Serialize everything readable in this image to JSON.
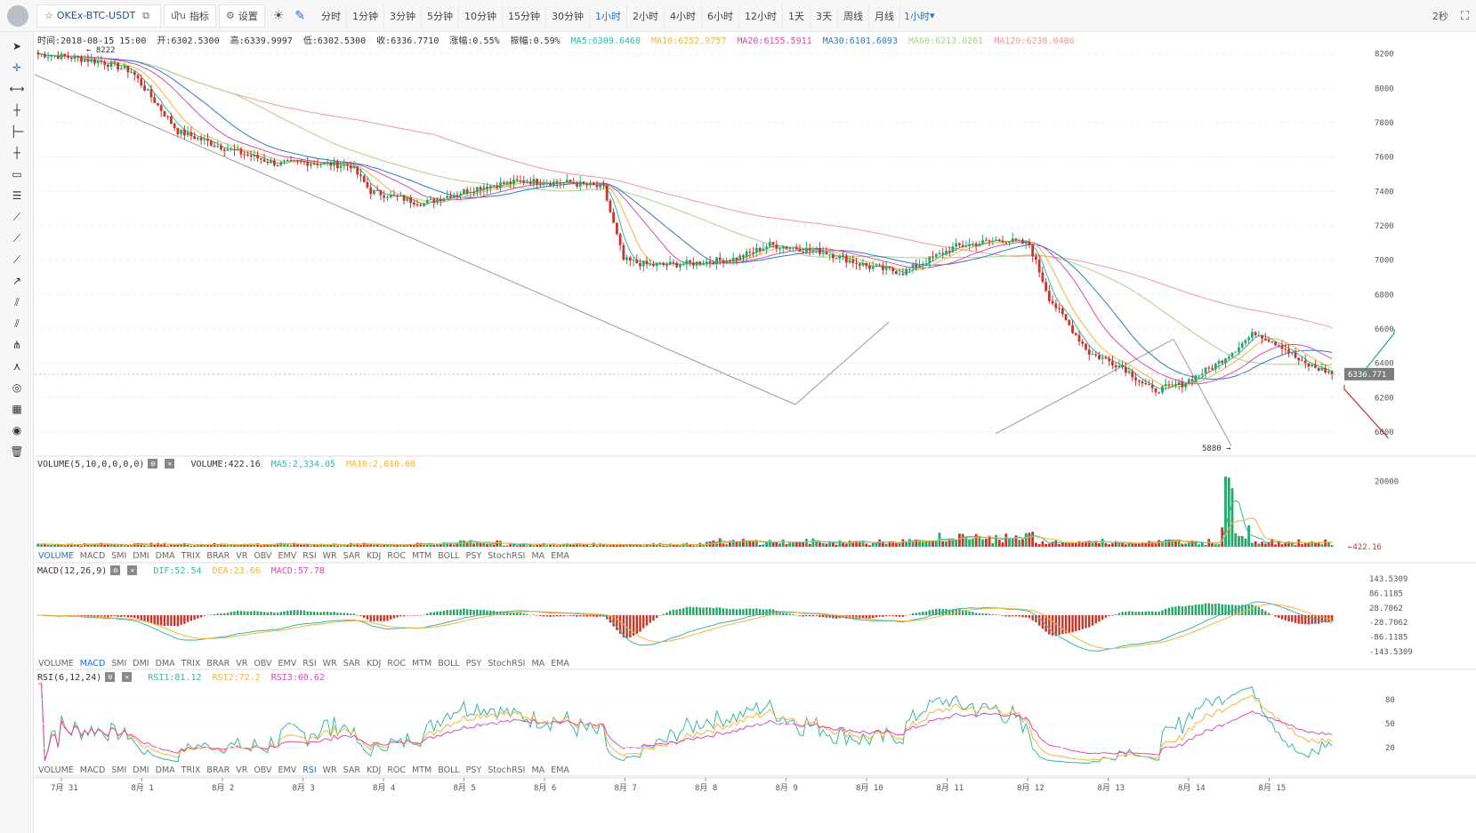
{
  "toolbar": {
    "symbol": "OKEx-BTC-USDT",
    "indicators_label": "指标",
    "settings_label": "设置",
    "timeframes": [
      "分时",
      "1分钟",
      "3分钟",
      "5分钟",
      "10分钟",
      "15分钟",
      "30分钟",
      "1小时",
      "2小时",
      "4小时",
      "6小时",
      "12小时",
      "1天",
      "3天",
      "周线",
      "月线"
    ],
    "active_timeframe": "1小时",
    "dropdown_label": "1小时",
    "interval_refresh": "2秒"
  },
  "ohlc": {
    "time": "时间:2018-08-15 15:00",
    "open": "开:6302.5300",
    "high": "高:6339.9997",
    "low": "低:6302.5300",
    "close": "收:6336.7710",
    "change": "涨幅:0.55%",
    "amplitude": "振幅:0.59%",
    "ma5": "MA5:6309.6468",
    "ma10": "MA10:6252.9757",
    "ma20": "MA20:6155.5911",
    "ma30": "MA30:6101.6093",
    "ma60": "MA60:6213.0261",
    "ma120": "MA120:6238.0486"
  },
  "price_axis": [
    "8200",
    "8000",
    "7800",
    "7600",
    "7400",
    "7200",
    "7000",
    "6800",
    "6600",
    "6400",
    "6200",
    "6000"
  ],
  "last_price": "6336.771",
  "high_marker": "← 8222",
  "low_marker": "5880 →",
  "volume": {
    "title": "VOLUME(5,10,0,0,0,0)",
    "value": "VOLUME:422.16",
    "ma5": "MA5:2,334.05",
    "ma10": "MA10:2,010.08",
    "axis": "20000",
    "last": "←422.16"
  },
  "macd": {
    "title": "MACD(12,26,9)",
    "dif": "DIF:52.54",
    "dea": "DEA:23.66",
    "macd": "MACD:57.78",
    "axis": [
      "143.5309",
      "86.1185",
      "28.7062",
      "-28.7062",
      "-86.1185",
      "-143.5309"
    ]
  },
  "rsi": {
    "title": "RSI(6,12,24)",
    "rsi1": "RSI1:81.12",
    "rsi2": "RSI2:72.2",
    "rsi3": "RSI3:60.62",
    "axis": [
      "80",
      "50",
      "20"
    ]
  },
  "indicator_tabs": [
    "VOLUME",
    "MACD",
    "SMI",
    "DMI",
    "DMA",
    "TRIX",
    "BRAR",
    "VR",
    "OBV",
    "EMV",
    "RSI",
    "WR",
    "SAR",
    "KDJ",
    "ROC",
    "MTM",
    "BOLL",
    "PSY",
    "StochRSI",
    "MA",
    "EMA"
  ],
  "date_axis": [
    "7月 31",
    "8月 1",
    "8月 2",
    "8月 3",
    "8月 4",
    "8月 5",
    "8月 6",
    "8月 7",
    "8月 8",
    "8月 9",
    "8月 10",
    "8月 11",
    "8月 12",
    "8月 13",
    "8月 14",
    "8月 15"
  ],
  "colors": {
    "up": "#2aa56a",
    "down": "#c8352b",
    "ma5": "#36b5a8",
    "ma10": "#f3b53a",
    "ma20": "#d94bb0",
    "ma30": "#2f79c8",
    "ma60": "#a8d28d",
    "ma120": "#ef9a9a",
    "accent": "#1e6fd9"
  }
}
